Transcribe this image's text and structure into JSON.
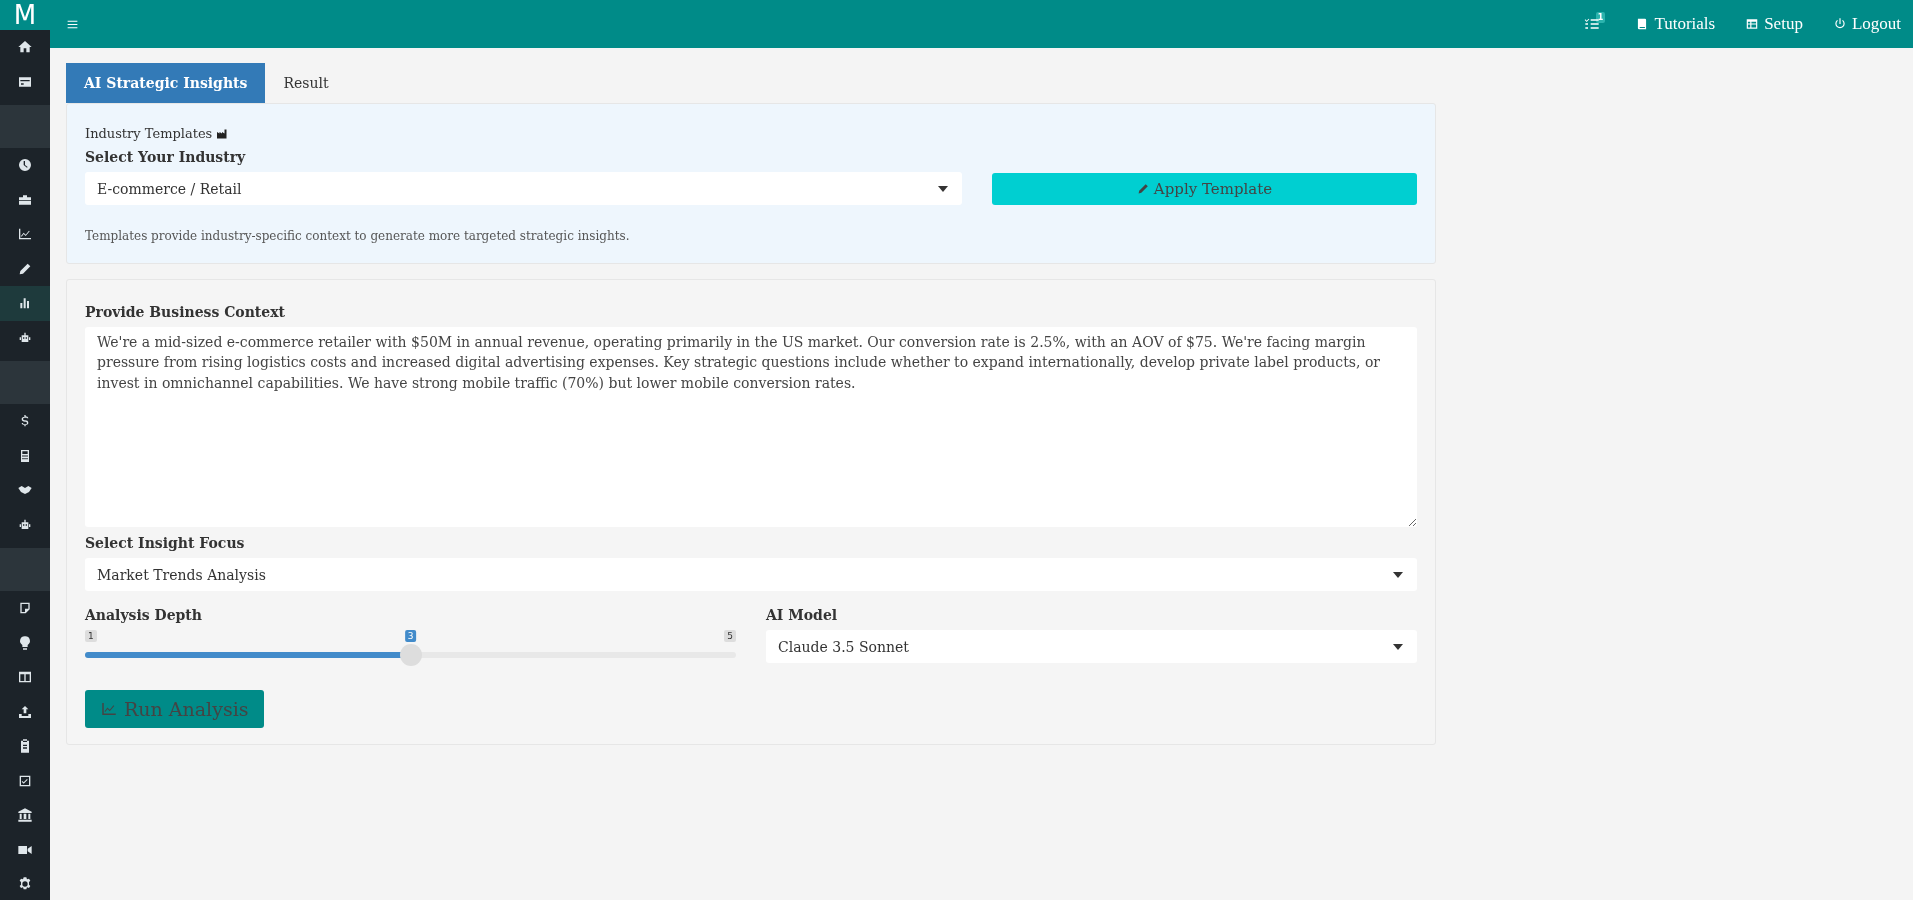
{
  "brand": {
    "logo": "M"
  },
  "topbar": {
    "tasks_badge": "1",
    "links": [
      {
        "label": "Tutorials",
        "kind": "book"
      },
      {
        "label": "Setup",
        "kind": "table"
      },
      {
        "label": "Logout",
        "kind": "power"
      }
    ]
  },
  "sidebar": {
    "groups": [
      {
        "items": [
          {
            "selected": false
          },
          {
            "selected": false
          }
        ]
      },
      {
        "items": [
          {
            "selected": false
          },
          {
            "selected": false
          },
          {
            "selected": false
          },
          {
            "selected": false
          },
          {
            "selected": true
          },
          {
            "selected": false
          }
        ]
      },
      {
        "items": [
          {
            "selected": false
          },
          {
            "selected": false
          },
          {
            "selected": false
          },
          {
            "selected": false
          }
        ]
      },
      {
        "items": [
          {
            "selected": false
          },
          {
            "selected": false
          },
          {
            "selected": false
          },
          {
            "selected": false
          },
          {
            "selected": false
          },
          {
            "selected": false
          },
          {
            "selected": false
          },
          {
            "selected": false
          },
          {
            "selected": false
          }
        ]
      }
    ]
  },
  "tabs": [
    {
      "label": "AI Strategic Insights",
      "selected": true
    },
    {
      "label": "Result",
      "selected": false
    }
  ],
  "templates": {
    "heading": "Industry Templates",
    "industry_label": "Select Your Industry",
    "industry_value": "E-commerce / Retail",
    "apply_button": "Apply Template",
    "note": "Templates provide industry-specific context to generate more targeted strategic insights."
  },
  "context": {
    "label": "Provide Business Context",
    "value": "We're a mid-sized e-commerce retailer with $50M in annual revenue, operating primarily in the US market. Our conversion rate is 2.5%, with an AOV of $75. We're facing margin pressure from rising logistics costs and increased digital advertising expenses. Key strategic questions include whether to expand internationally, develop private label products, or invest in omnichannel capabilities. We have strong mobile traffic (70%) but lower mobile conversion rates."
  },
  "focus": {
    "label": "Select Insight Focus",
    "value": "Market Trends Analysis"
  },
  "depth": {
    "label": "Analysis Depth",
    "min": "1",
    "max": "5",
    "reading": "3",
    "level": 0.5
  },
  "model": {
    "label": "AI Model",
    "value": "Claude 3.5 Sonnet"
  },
  "run_button": "Run Analysis"
}
